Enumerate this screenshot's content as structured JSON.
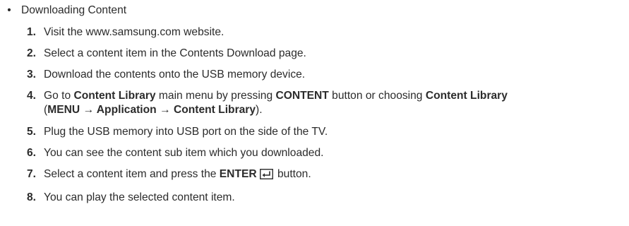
{
  "section": {
    "bullet": "•",
    "title": "Downloading Content"
  },
  "steps": [
    {
      "num": "1.",
      "parts": [
        "Visit the www.samsung.com website."
      ]
    },
    {
      "num": "2.",
      "parts": [
        "Select a content item in the Contents Download page."
      ]
    },
    {
      "num": "3.",
      "parts": [
        "Download the contents onto the USB memory device."
      ]
    },
    {
      "num": "4.",
      "parts": [
        "Go to ",
        "Content Library",
        " main menu by pressing ",
        "CONTENT",
        " button or choosing ",
        "Content Library",
        " (",
        "MENU → Application → Content Library",
        ")."
      ]
    },
    {
      "num": "5.",
      "parts": [
        "Plug the USB memory into USB port on the side of the TV."
      ]
    },
    {
      "num": "6.",
      "parts": [
        "You can see the content sub item which you downloaded."
      ]
    },
    {
      "num": "7.",
      "parts": [
        "Select a content item and press the ",
        "ENTER",
        " button."
      ]
    },
    {
      "num": "8.",
      "parts": [
        "You can play the selected content item."
      ]
    }
  ],
  "icons": {
    "enter": "enter-icon"
  }
}
